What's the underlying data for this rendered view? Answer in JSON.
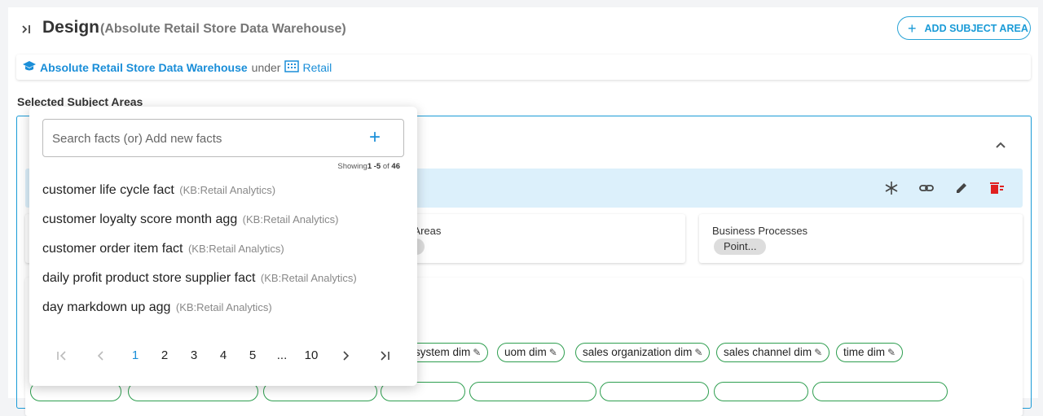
{
  "header": {
    "title": "Design",
    "subtitle": "(Absolute Retail Store Data Warehouse)",
    "add_button": "ADD SUBJECT AREA"
  },
  "breadcrumb": {
    "warehouse": "Absolute Retail Store Data Warehouse",
    "under": "under",
    "domain": "Retail"
  },
  "selected_label": "Selected Subject Areas",
  "cards": {
    "areas_title": "s Areas",
    "processes_title": "Business Processes",
    "processes_pill": "Point..."
  },
  "dimensions": [
    {
      "label": "system dim"
    },
    {
      "label": "uom dim"
    },
    {
      "label": "sales organization dim"
    },
    {
      "label": "sales channel dim"
    },
    {
      "label": "time dim"
    }
  ],
  "popup": {
    "search_placeholder": "Search facts (or) Add new facts",
    "showing_prefix": "Showing",
    "showing_range": "1 -5",
    "showing_of": "of",
    "showing_total": "46",
    "facts": [
      {
        "name": "customer life cycle fact",
        "kb": "(KB:Retail Analytics)"
      },
      {
        "name": "customer loyalty score month agg",
        "kb": "(KB:Retail Analytics)"
      },
      {
        "name": "customer order item fact",
        "kb": "(KB:Retail Analytics)"
      },
      {
        "name": "daily profit product store supplier fact",
        "kb": "(KB:Retail Analytics)"
      },
      {
        "name": "day markdown up agg",
        "kb": "(KB:Retail Analytics)"
      }
    ],
    "pages": [
      "1",
      "2",
      "3",
      "4",
      "5",
      "...",
      "10"
    ],
    "current_page": "1"
  },
  "colors": {
    "accent": "#1a8ed8",
    "tag_border": "#2e9e4f",
    "strip_bg": "#dcf0fb",
    "delete": "#e02020"
  }
}
